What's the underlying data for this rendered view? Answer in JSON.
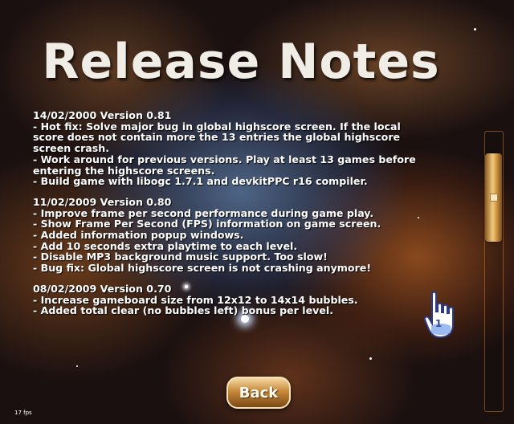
{
  "title": "Release Notes",
  "notes": [
    "14/02/2000 Version 0.81",
    "- Hot fix: Solve major bug in global highscore screen. If the local",
    "  score does not contain more the 13 entries the global highscore",
    "  screen crash.",
    "- Work around for previous versions. Play at least 13 games before",
    "  entering the highscore screens.",
    "- Build game with libogc 1.7.1 and devkitPPC r16 compiler.",
    "",
    "11/02/2009 Version 0.80",
    "- Improve frame per second performance during game play.",
    "- Show Frame Per Second (FPS) information on game screen.",
    "- Added information popup windows.",
    "- Add 10 seconds extra playtime to each level.",
    "- Disable MP3 background music support. Too slow!",
    "- Bug fix: Global highscore screen is not crashing anymore!",
    "",
    "08/02/2009 Version 0.70",
    "- Increase gameboard size from 12x12 to 14x14 bubbles.",
    "- Added total clear (no bubbles left) bonus per level."
  ],
  "cursor_player": "1",
  "back_label": "Back",
  "fps_label": "17 fps",
  "colors": {
    "button": "#c88a3a",
    "scroll": "#e0a850",
    "text": "#ffffff"
  }
}
